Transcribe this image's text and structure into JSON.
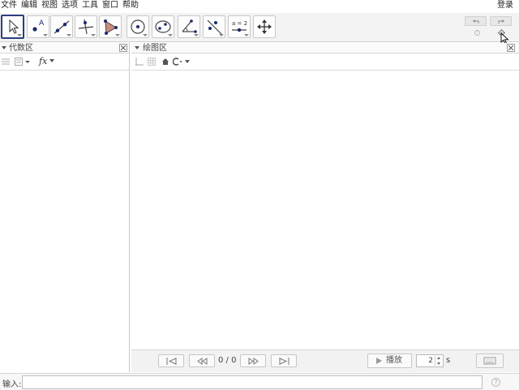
{
  "menu": {
    "items": [
      {
        "label": "文件"
      },
      {
        "label": "编辑"
      },
      {
        "label": "视图"
      },
      {
        "label": "选项"
      },
      {
        "label": "工具"
      },
      {
        "label": "窗口"
      },
      {
        "label": "帮助"
      }
    ],
    "login": "登录"
  },
  "toolbar": {
    "tools": [
      {
        "icon": "move-arrow-icon",
        "selected": true
      },
      {
        "icon": "point-icon"
      },
      {
        "icon": "line-icon"
      },
      {
        "icon": "perpendicular-line-icon"
      },
      {
        "icon": "polygon-icon"
      },
      {
        "icon": "circle-center-point-icon"
      },
      {
        "icon": "conic-ellipse-icon"
      },
      {
        "icon": "angle-icon"
      },
      {
        "icon": "reflect-icon"
      },
      {
        "icon": "slider-icon",
        "text": "a = 2"
      },
      {
        "icon": "move-graphics-view-icon"
      }
    ],
    "help_glyph": "?"
  },
  "algebra": {
    "title": "代数区",
    "fx": "fx"
  },
  "graphics": {
    "title": "绘图区"
  },
  "animation": {
    "frame_count": "0 / 0",
    "play_label": "播放",
    "speed_value": "2",
    "speed_unit": "s"
  },
  "input": {
    "label": "输入:",
    "value": "",
    "help_glyph": "?"
  },
  "colors": {
    "selected_border": "#2c3e80",
    "point_blue": "#1a2a6c",
    "polygon_fill": "#c98a7a"
  }
}
